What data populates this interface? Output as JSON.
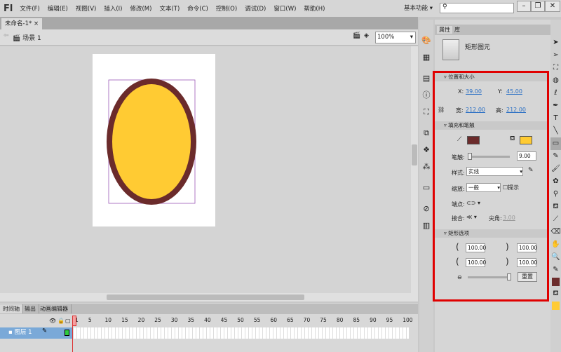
{
  "app": {
    "logo": "Fl",
    "menus": [
      "文件(F)",
      "编辑(E)",
      "视图(V)",
      "插入(I)",
      "修改(M)",
      "文本(T)",
      "命令(C)",
      "控制(O)",
      "调试(D)",
      "窗口(W)",
      "帮助(H)"
    ],
    "workspace": "基本功能 ▾",
    "search_placeholder": "",
    "window_buttons": [
      "–",
      "❐",
      "✕"
    ]
  },
  "document": {
    "tab": "未命名-1*",
    "close": "×",
    "scene": "场景 1",
    "zoom": "100%"
  },
  "stage": {
    "shape_fill": "#FFCB33",
    "shape_stroke": "#6B2B2B"
  },
  "timeline": {
    "tabs": [
      "时间轴",
      "输出",
      "动画编辑器"
    ],
    "ticks": [
      "1",
      "5",
      "10",
      "15",
      "20",
      "25",
      "30",
      "35",
      "40",
      "45",
      "50",
      "55",
      "60",
      "65",
      "70",
      "75",
      "80",
      "85",
      "90",
      "95",
      "100"
    ],
    "layer": "图层 1"
  },
  "panel": {
    "tabs": [
      "属性",
      "库"
    ],
    "object_type": "矩形图元",
    "position": {
      "title": "位置和大小",
      "x_label": "X:",
      "x": "39.00",
      "y_label": "Y:",
      "y": "45.00",
      "w_label": "宽:",
      "w": "212.00",
      "h_label": "高:",
      "h": "212.00"
    },
    "fill": {
      "title": "填充和笔触",
      "stroke_color": "#6B2B2B",
      "fill_color": "#FFCB33",
      "stroke_label": "笔触:",
      "stroke_value": "9.00",
      "style_label": "样式:",
      "style": "实线",
      "scale_label": "缩放:",
      "scale": "一般",
      "hint": "提示",
      "cap_label": "端点:",
      "join_label": "接合:",
      "miter_label": "尖角:",
      "miter": "3.00"
    },
    "rect": {
      "title": "矩形选项",
      "corners": [
        "100.00",
        "100.00",
        "100.00",
        "100.00"
      ],
      "reset": "重置"
    }
  },
  "highlight_color": "#E00000"
}
